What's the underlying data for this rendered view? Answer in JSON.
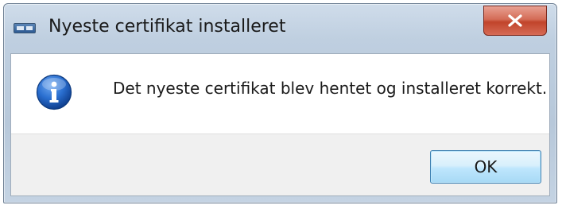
{
  "window": {
    "title": "Nyeste certifikat installeret",
    "app_icon": "certificate-app-icon",
    "close_icon": "close-x-icon"
  },
  "message": {
    "icon": "info-icon",
    "text": "Det nyeste certifikat blev hentet og installeret korrekt."
  },
  "buttons": {
    "ok_label": "OK"
  },
  "colors": {
    "title_bar": "#bfcfe0",
    "close_button": "#c1442b",
    "info_icon": "#1f5fbf",
    "ok_button_border": "#3c7fb1",
    "button_area": "#f0f0f0"
  }
}
